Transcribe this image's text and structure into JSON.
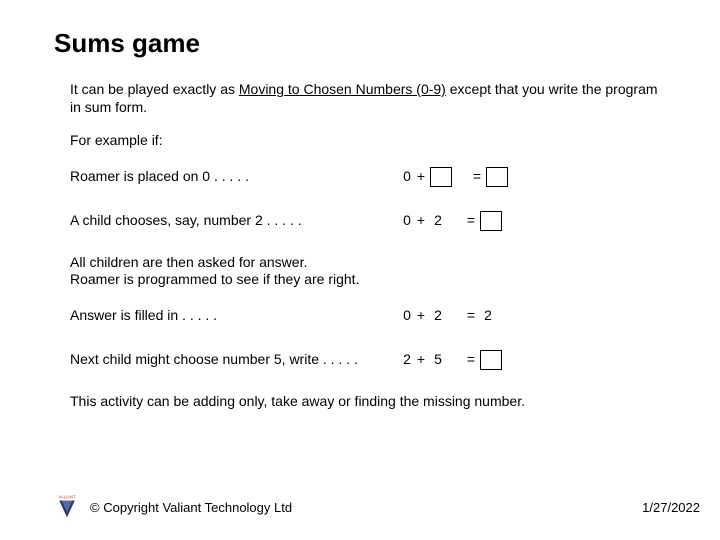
{
  "title": "Sums game",
  "intro_prefix": "It can be played exactly as ",
  "intro_link": "Moving to Chosen Numbers (0-9)",
  "intro_suffix": " except that you write the program in sum form.",
  "for_example": "For example if:",
  "rows": [
    {
      "text": "Roamer is placed on 0 . . . . .",
      "a": "0",
      "op": "+",
      "b_box": true,
      "b": "",
      "eq": "=",
      "r_box": true,
      "r": ""
    },
    {
      "text": "A child chooses, say, number 2 . . . . .",
      "a": "0",
      "op": "+",
      "b_box": false,
      "b": "2",
      "eq": "=",
      "r_box": true,
      "r": ""
    }
  ],
  "mid_para_1": "All children are then asked for answer.",
  "mid_para_2": "Roamer is programmed to see if they are right.",
  "rows2": [
    {
      "text": "Answer is filled in . . . . .",
      "a": "0",
      "op": "+",
      "b_box": false,
      "b": "2",
      "eq": "=",
      "r_box": false,
      "r": "2"
    },
    {
      "text": "Next child might choose number 5, write . . . . .",
      "a": "2",
      "op": "+",
      "b_box": false,
      "b": "5",
      "eq": "=",
      "r_box": true,
      "r": ""
    }
  ],
  "closing": "This activity can be adding only, take away or finding the missing number.",
  "copyright": "Copyright Valiant Technology Ltd",
  "copy_symbol": "©",
  "date": "1/27/2022",
  "logo_label": "VALIANT"
}
